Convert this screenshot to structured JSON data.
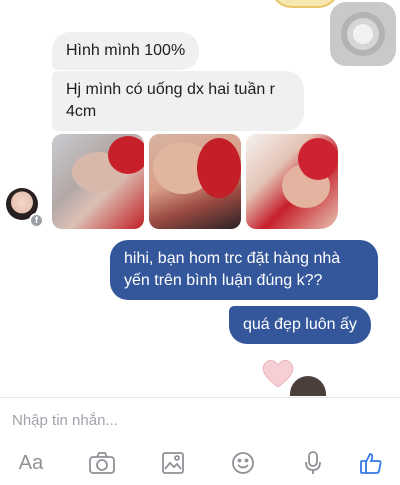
{
  "chat": {
    "messages": [
      {
        "from": "them",
        "text": "Hình mình 100%"
      },
      {
        "from": "them",
        "text": "Hj mình có uống dx hai tuần r 4cm"
      },
      {
        "from": "me",
        "text": "hihi, bạn hom trc đặt hàng nhà yến trên bình luận đúng k??"
      },
      {
        "from": "me",
        "text": "quá đẹp luôn ấy"
      }
    ],
    "photos_shared": 3
  },
  "composer": {
    "placeholder": "Nhập tin nhắn...",
    "aa_label": "Aa",
    "icons": [
      "text-format-icon",
      "camera-icon",
      "photo-gallery-icon",
      "emoji-icon",
      "microphone-icon",
      "like-icon"
    ]
  },
  "colors": {
    "outgoing_bubble": "#34579c",
    "incoming_bubble": "#f1f0f0",
    "like_icon": "#3578e5",
    "toolbar_icon": "#8e9196"
  }
}
